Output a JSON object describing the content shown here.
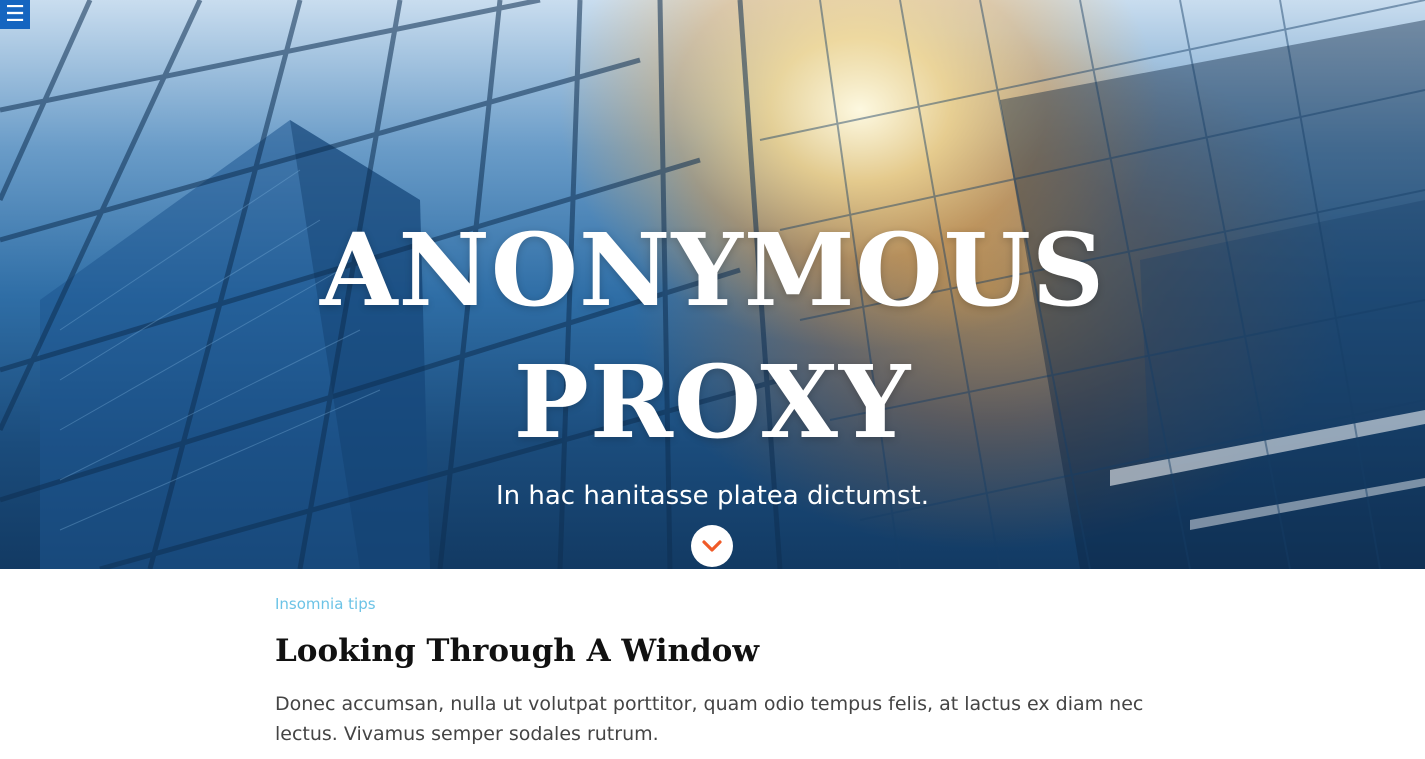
{
  "colors": {
    "menu_button_bg": "#1565c0",
    "category_link": "#6cc3e6",
    "accent_chevron": "#f05a28",
    "title_text": "#111111",
    "body_text": "#444444"
  },
  "header": {
    "menu_icon": "hamburger-icon",
    "menu_glyph": "☰"
  },
  "hero": {
    "title_line1": "ANONYMOUS",
    "title_line2": "PROXY",
    "subtitle": "In hac hanitasse platea dictumst.",
    "scroll_icon": "chevron-down-icon"
  },
  "post": {
    "category": "Insomnia tips",
    "title": "Looking Through A Window",
    "excerpt": "Donec accumsan, nulla ut volutpat porttitor, quam odio tempus felis, at lactus ex diam nec lectus. Vivamus semper sodales rutrum."
  }
}
